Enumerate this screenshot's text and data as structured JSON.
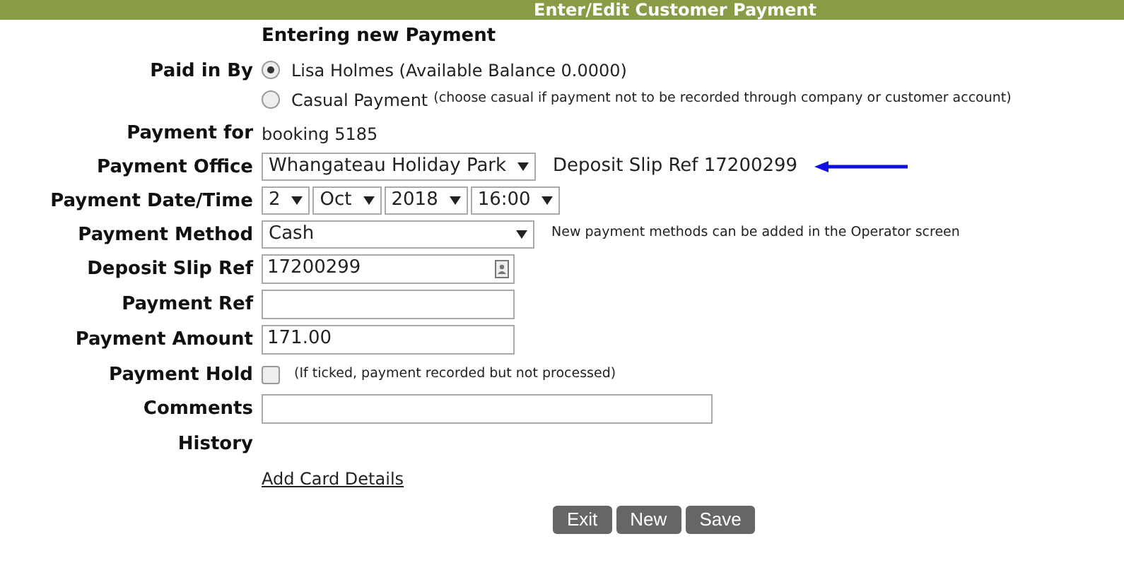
{
  "header": {
    "title": "Enter/Edit Customer Payment"
  },
  "heading": "Entering new Payment",
  "rows": [
    {
      "kind": "radio",
      "label": "Paid in By",
      "options": [
        {
          "text": "Lisa Holmes (Available Balance 0.0000)",
          "selected": true
        },
        {
          "text": "Casual Payment",
          "note": "(choose casual if payment not to be recorded through company or customer account)",
          "selected": false
        }
      ]
    },
    {
      "kind": "text",
      "label": "Payment for",
      "value": "booking 5185"
    },
    {
      "kind": "select",
      "label": "Payment Office",
      "value": "Whangateau Holiday Park",
      "note": "Deposit Slip Ref 17200299",
      "arrow": true
    },
    {
      "kind": "selects",
      "label": "Payment Date/Time",
      "values": [
        "2",
        "Oct",
        "2018",
        "16:00"
      ]
    },
    {
      "kind": "select",
      "label": "Payment Method",
      "value": "Cash",
      "note": "New payment methods can be added in the Operator screen",
      "wide": true
    },
    {
      "kind": "input",
      "label": "Deposit Slip Ref",
      "value": "17200299",
      "contact_icon": true
    },
    {
      "kind": "input",
      "label": "Payment Ref"
    },
    {
      "kind": "input",
      "label": "Payment Amount",
      "value": "171.00"
    },
    {
      "kind": "checkbox",
      "label": "Payment Hold",
      "checked": false,
      "note": "(If ticked, payment recorded but not processed)"
    },
    {
      "kind": "input",
      "label": "Comments",
      "wide": true
    },
    {
      "kind": "label",
      "label": "History"
    },
    {
      "kind": "link",
      "value": "Add Card Details"
    }
  ],
  "buttons": [
    "Exit",
    "New",
    "Save"
  ]
}
